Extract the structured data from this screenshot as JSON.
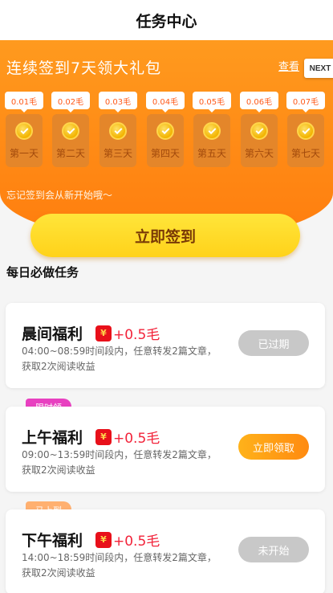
{
  "header": {
    "title": "任务中心"
  },
  "banner": {
    "title": "连续签到7天领大礼包",
    "view_link": "查看",
    "next_chip": "NEXT",
    "remind": "忘记签到会从新开始哦～",
    "days": [
      {
        "amount": "0.01毛",
        "label": "第一天"
      },
      {
        "amount": "0.02毛",
        "label": "第二天"
      },
      {
        "amount": "0.03毛",
        "label": "第三天"
      },
      {
        "amount": "0.04毛",
        "label": "第四天"
      },
      {
        "amount": "0.05毛",
        "label": "第五天"
      },
      {
        "amount": "0.06毛",
        "label": "第六天"
      },
      {
        "amount": "0.07毛",
        "label": "第七天"
      }
    ]
  },
  "signin_button": "立即签到",
  "section_title": "每日必做任务",
  "reward_symbol": "¥",
  "tasks": [
    {
      "name": "晨间福利",
      "reward": "+0.5毛",
      "desc": "04:00~08:59时间段内，任意转发2篇文章，获取2次阅读收益",
      "action": "已过期",
      "tag": ""
    },
    {
      "name": "上午福利",
      "reward": "+0.5毛",
      "desc": "09:00~13:59时间段内，任意转发2篇文章，获取2次阅读收益",
      "action": "立即领取",
      "tag": "限时领"
    },
    {
      "name": "下午福利",
      "reward": "+0.5毛",
      "desc": "14:00~18:59时间段内，任意转发2篇文章，获取2次阅读收益",
      "action": "未开始",
      "tag": "马上到"
    }
  ]
}
